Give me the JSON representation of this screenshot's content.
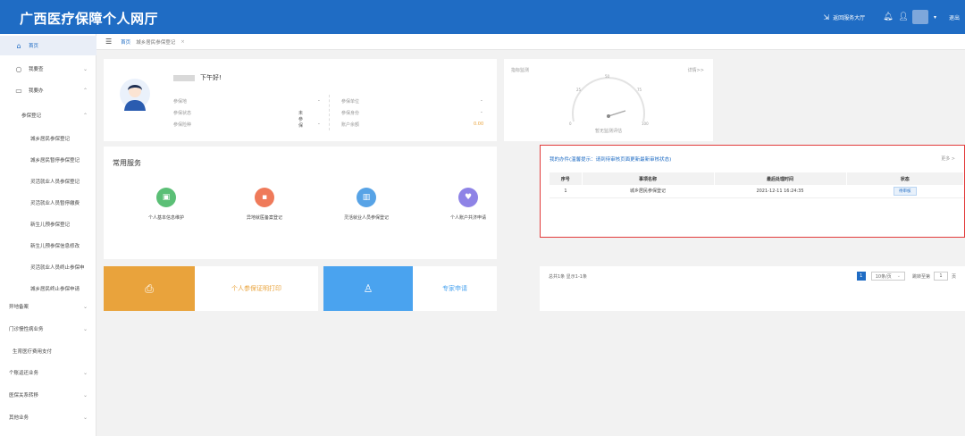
{
  "header": {
    "title": "广西医疗保障个人网厅",
    "service_hall": "返回服务大厅",
    "logout": "退出"
  },
  "sidebar": {
    "home": "首页",
    "query": "我要查",
    "handle": "我要办",
    "reg_group": "参保登记",
    "sub": [
      "城乡居民参保登记",
      "城乡居民暂停参保登记",
      "灵活就业人员参保登记",
      "灵活就业人员暂停缴费",
      "新生儿预参保登记",
      "新生儿预参保信息修改",
      "灵活就业人员终止参保申",
      "城乡居民终止参保申请"
    ],
    "groups": [
      "异地备案",
      "门诊慢性病业务",
      "生育医疗费用支付",
      "个账返还业务",
      "医保关系转移",
      "其他业务"
    ]
  },
  "tabs": {
    "home": "首页",
    "current": "城乡居民参保登记",
    "close": "×"
  },
  "profile": {
    "greeting": "下午好!",
    "fields": [
      {
        "label": "参保地",
        "value": "-"
      },
      {
        "label": "参保状态",
        "value": "未参保"
      },
      {
        "label": "参保险种",
        "value": "-"
      },
      {
        "label": "参保单位",
        "value": "-"
      },
      {
        "label": "参保身份",
        "value": "-"
      },
      {
        "label": "账户余额",
        "value": "0.00"
      }
    ]
  },
  "gauge": {
    "title": "指标监测",
    "more": "详情>>",
    "caption": "暂无监测评估",
    "ticks": [
      "0",
      "25",
      "50",
      "75",
      "100"
    ]
  },
  "services": {
    "title": "常用服务",
    "items": [
      {
        "label": "个人基本信息维护"
      },
      {
        "label": "异地就医备案登记"
      },
      {
        "label": "灵活就业人员参保登记"
      },
      {
        "label": "个人账户共济申请"
      }
    ]
  },
  "tiles": {
    "print_label": "个人参保证明打印",
    "expert_label": "专家申请"
  },
  "todo": {
    "title": "我的办件(温馨提示：请到待审核页面更新最新审核状态)",
    "more": "更多 >",
    "headers": [
      "序号",
      "事项名称",
      "最后处理时间",
      "状态"
    ],
    "rows": [
      {
        "no": "1",
        "name": "城乡居民参保登记",
        "time": "2021-12-11 16:24:35",
        "status": "待审核"
      }
    ]
  },
  "pager": {
    "info": "总共1条 显示1-1条",
    "page": "1",
    "size": "10条/页",
    "goto_label": "跳转至第",
    "goto_value": "1",
    "unit": "页"
  },
  "colors": {
    "brand": "#1f6cc4",
    "orange": "#e9a33c",
    "sky": "#4aa3ef",
    "highlight": "#e23b3b"
  }
}
